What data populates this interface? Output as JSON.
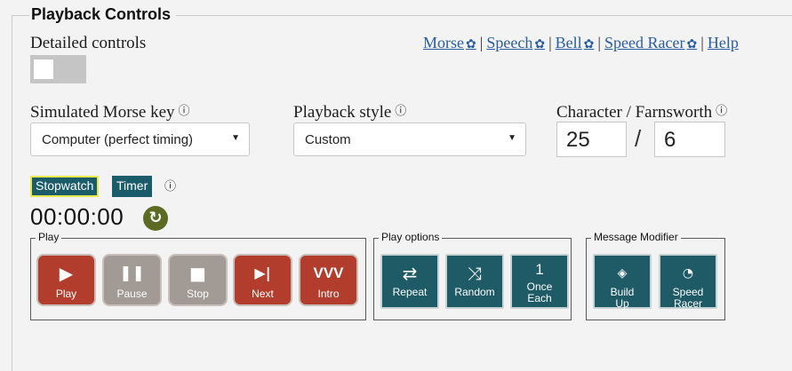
{
  "section_title": "Playback Controls",
  "detailed_controls": {
    "label": "Detailed controls",
    "enabled": false
  },
  "help_links": [
    {
      "label": "Morse",
      "gear": true
    },
    {
      "label": "Speech",
      "gear": true
    },
    {
      "label": "Bell",
      "gear": true
    },
    {
      "label": "Speed Racer",
      "gear": true
    },
    {
      "label": "Help",
      "gear": false
    }
  ],
  "separator": "|",
  "icons": {
    "info": "ⓘ",
    "gear": "✿",
    "reset": "↻"
  },
  "morse_key": {
    "label": "Simulated Morse key",
    "value": "Computer (perfect timing)"
  },
  "playback_style": {
    "label": "Playback style",
    "value": "Custom"
  },
  "speed": {
    "label": "Character / Farnsworth",
    "character": "25",
    "farnsworth": "6",
    "separator": "/"
  },
  "timer": {
    "stopwatch_label": "Stopwatch",
    "timer_label": "Timer",
    "active": "Stopwatch",
    "display": "00:00:00"
  },
  "play_group": {
    "title": "Play",
    "buttons": [
      {
        "label": "Play",
        "icon": "play-icon",
        "glyph": "▶"
      },
      {
        "label": "Pause",
        "icon": "pause-icon",
        "glyph": "❚❚"
      },
      {
        "label": "Stop",
        "icon": "stop-icon",
        "glyph": "■"
      },
      {
        "label": "Next",
        "icon": "next-icon",
        "glyph": "▶|"
      },
      {
        "label": "Intro",
        "icon": "vvv-icon",
        "glyph": "VVV"
      }
    ]
  },
  "play_options": {
    "title": "Play options",
    "buttons": [
      {
        "label": "Repeat",
        "icon": "repeat-icon",
        "glyph": "⇄"
      },
      {
        "label": "Random",
        "icon": "shuffle-icon",
        "glyph": "⤨"
      },
      {
        "label": "Once Each",
        "icon": "once-icon",
        "glyph": "1"
      }
    ]
  },
  "message_modifier": {
    "title": "Message Modifier",
    "buttons": [
      {
        "label": "Build Up",
        "icon": "layers-icon",
        "glyph": "◈"
      },
      {
        "label": "Speed Racer",
        "icon": "speedometer-icon",
        "glyph": "◔"
      }
    ]
  },
  "colors": {
    "play_red": "#b23d2c",
    "disabled_grey": "#a29a95",
    "teal": "#1e5b66",
    "tab_teal": "#1b5c6b",
    "active_outline": "#e8e84a",
    "link": "#2a5d9f",
    "reset_green": "#5b6b23"
  }
}
